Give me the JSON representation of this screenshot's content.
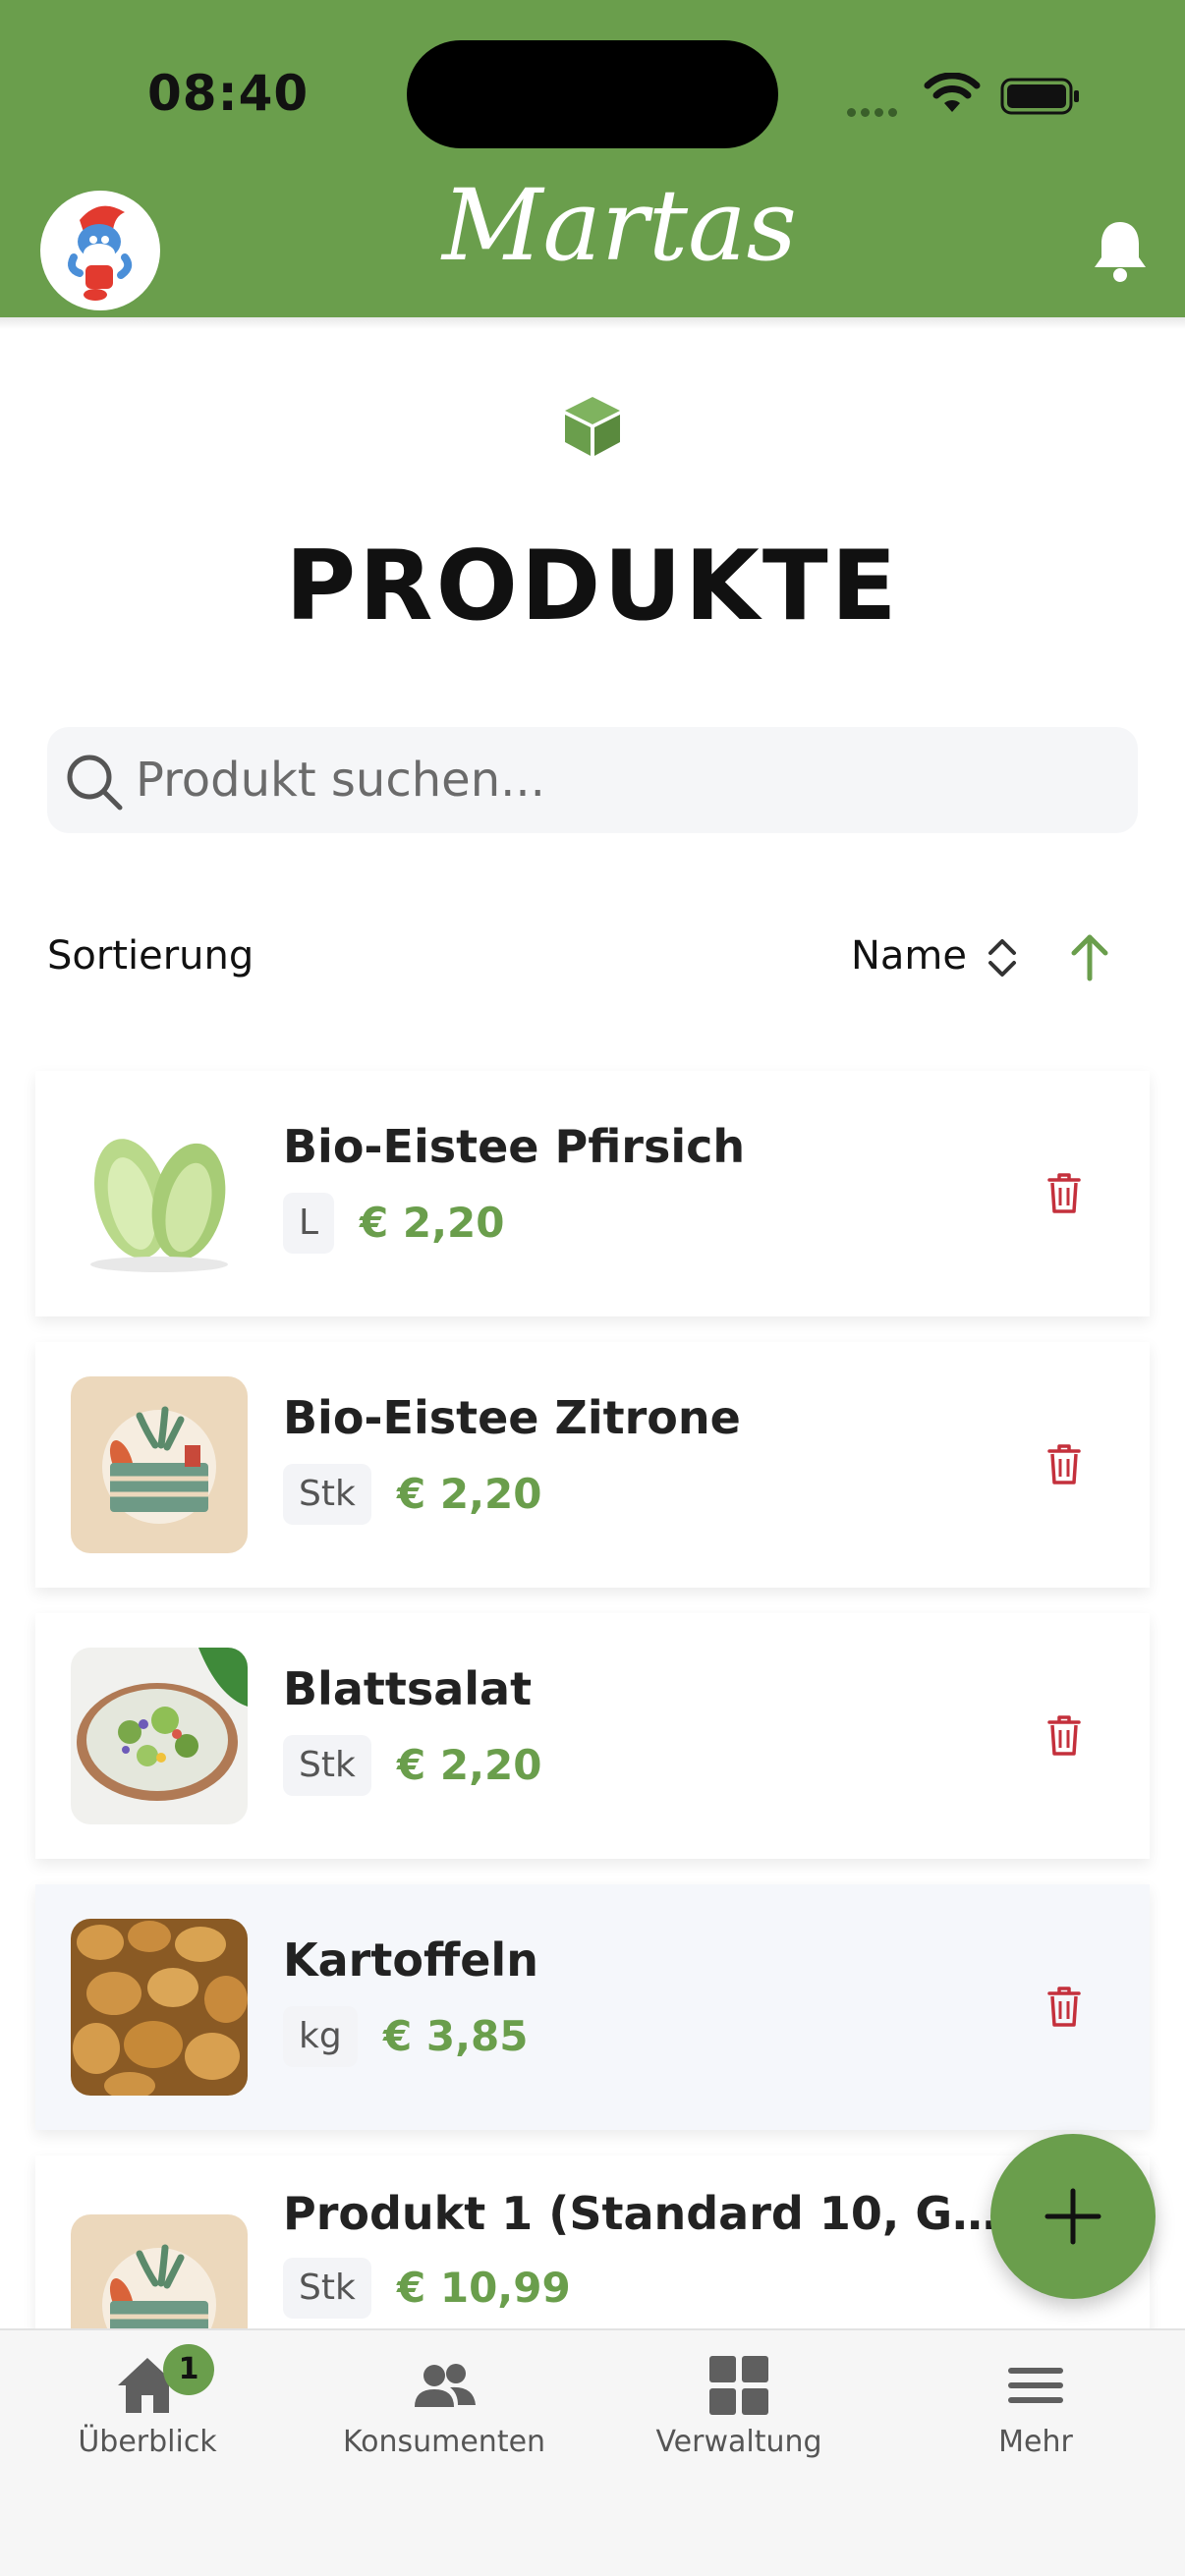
{
  "status_bar": {
    "time": "08:40"
  },
  "header": {
    "brand": "Martas"
  },
  "page": {
    "title": "PRODUKTE"
  },
  "search": {
    "placeholder": "Produkt suchen..."
  },
  "sort": {
    "label": "Sortierung",
    "field": "Name",
    "direction": "ascending"
  },
  "products": [
    {
      "name": "Bio-Eistee Pfirsich",
      "unit": "L",
      "price": "€ 2,20",
      "image": "lettuce-photo"
    },
    {
      "name": "Bio-Eistee Zitrone",
      "unit": "Stk",
      "price": "€ 2,20",
      "image": "crate-placeholder"
    },
    {
      "name": "Blattsalat",
      "unit": "Stk",
      "price": "€ 2,20",
      "image": "salad-bowl-photo"
    },
    {
      "name": "Kartoffeln",
      "unit": "kg",
      "price": "€ 3,85",
      "image": "potatoes-photo"
    },
    {
      "name": "Produkt 1 (Standard 10, Gru...",
      "unit": "Stk",
      "price": "€ 10,99",
      "image": "crate-placeholder"
    }
  ],
  "fab": {
    "icon": "plus-icon"
  },
  "nav": [
    {
      "label": "Überblick",
      "icon": "home-icon",
      "badge": "1"
    },
    {
      "label": "Konsumenten",
      "icon": "users-icon"
    },
    {
      "label": "Verwaltung",
      "icon": "grid-icon"
    },
    {
      "label": "Mehr",
      "icon": "menu-icon"
    }
  ],
  "colors": {
    "brand_green": "#6a9e4c",
    "danger": "#c4303c",
    "surface_alt": "#f5f7fb"
  }
}
